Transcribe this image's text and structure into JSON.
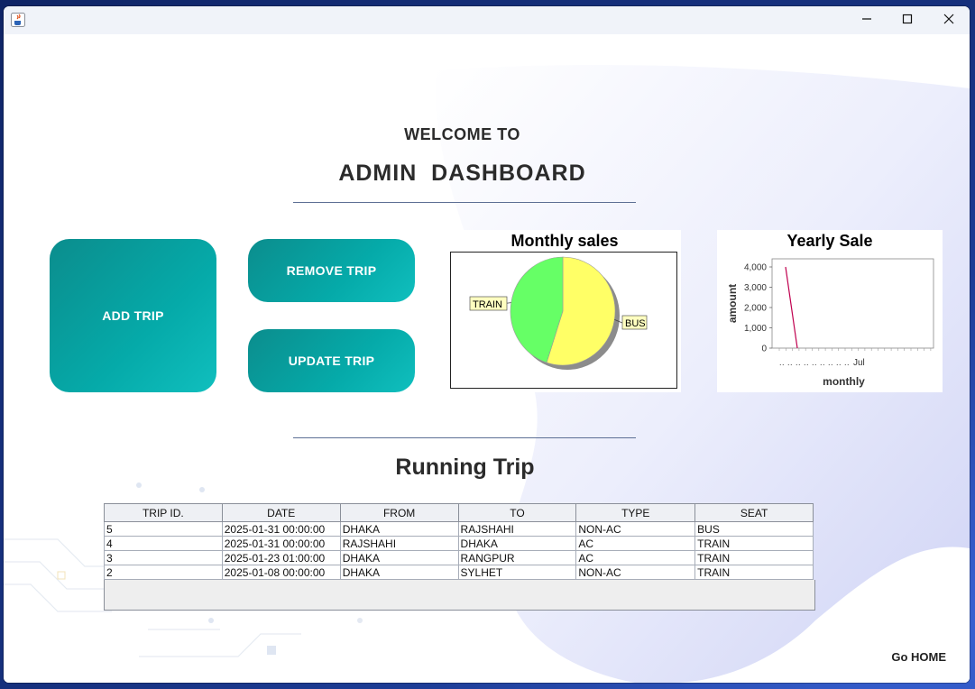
{
  "window": {
    "minimize_icon": "minimize-icon",
    "maximize_icon": "maximize-icon",
    "close_icon": "close-icon",
    "app_icon": "java-cup-icon"
  },
  "header": {
    "welcome": "WELCOME TO",
    "title": "ADMIN  DASHBOARD"
  },
  "actions": {
    "add_trip": "ADD TRIP",
    "remove_trip": "REMOVE TRIP",
    "update_trip": "UPDATE TRIP"
  },
  "colors": {
    "tile_teal": "#05aaa9",
    "pie_bus": "#ffff66",
    "pie_train": "#66ff66",
    "line": "#c0004f"
  },
  "chart_data": [
    {
      "type": "pie",
      "title": "Monthly sales",
      "slices": [
        {
          "label": "BUS",
          "value": 55,
          "color": "#ffff66"
        },
        {
          "label": "TRAIN",
          "value": 45,
          "color": "#66ff66"
        }
      ]
    },
    {
      "type": "line",
      "title": "Yearly Sale",
      "xlabel": "monthly",
      "ylabel": "amount",
      "x_tick_label": "Jul",
      "y_ticks": [
        "4,000",
        "3,000",
        "2,000",
        "1,000",
        "0"
      ],
      "ylim": [
        0,
        4400
      ],
      "series": [
        {
          "values": [
            4000,
            0
          ]
        }
      ]
    }
  ],
  "running": {
    "title": "Running Trip",
    "columns": [
      "TRIP ID.",
      "DATE",
      "FROM",
      "TO",
      "TYPE",
      "SEAT"
    ],
    "rows": [
      [
        "5",
        "2025-01-31 00:00:00",
        "DHAKA",
        "RAJSHAHI",
        "NON-AC",
        "BUS"
      ],
      [
        "4",
        "2025-01-31 00:00:00",
        "RAJSHAHI",
        "DHAKA",
        "AC",
        "TRAIN"
      ],
      [
        "3",
        "2025-01-23 01:00:00",
        "DHAKA",
        "RANGPUR",
        "AC",
        "TRAIN"
      ],
      [
        "2",
        "2025-01-08 00:00:00",
        "DHAKA",
        "SYLHET",
        "NON-AC",
        "TRAIN"
      ]
    ]
  },
  "footer": {
    "go_home": "Go HOME"
  }
}
